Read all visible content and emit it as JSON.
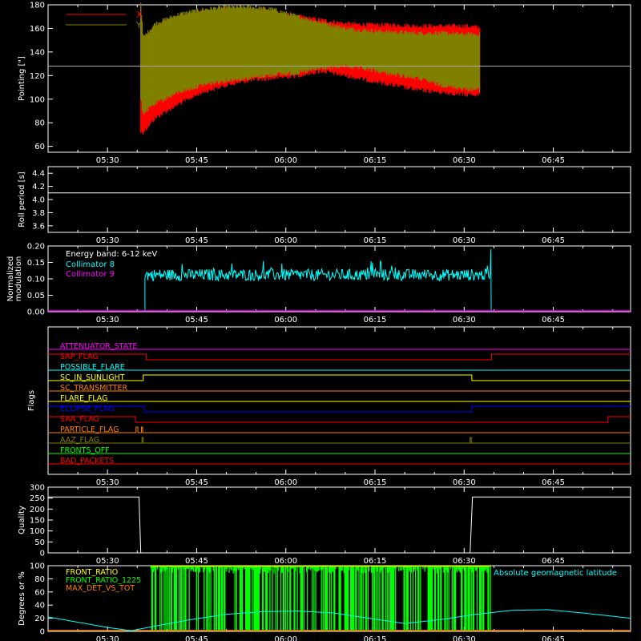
{
  "time_axis": {
    "ticks": [
      "05:30",
      "05:45",
      "06:00",
      "06:15",
      "06:30",
      "06:45"
    ],
    "tick_minutes": [
      330,
      345,
      360,
      375,
      390,
      405
    ],
    "range_minutes": [
      320,
      418
    ]
  },
  "chart_data": [
    {
      "id": "pointing",
      "type": "line",
      "ylabel": "Pointing [\"]",
      "ylim": [
        55,
        180
      ],
      "yticks": [
        60,
        80,
        100,
        120,
        140,
        160,
        180
      ],
      "reference_line": 128,
      "legend": [
        {
          "name": "X",
          "color": "#ff0000"
        },
        {
          "name": "Y",
          "color": "#808000"
        }
      ],
      "series": [
        {
          "name": "X",
          "color": "#ff0000",
          "x": [
            335.6,
            336,
            338,
            342,
            346,
            350,
            354,
            358,
            362,
            366,
            370,
            374,
            378,
            382,
            386,
            390,
            392.7
          ],
          "upper": [
            178,
            150,
            162,
            170,
            174,
            176,
            176,
            174,
            170,
            167,
            164,
            163,
            163,
            162,
            162,
            162,
            161
          ],
          "lower": [
            72,
            72,
            84,
            96,
            106,
            112,
            116,
            118,
            120,
            124,
            120,
            116,
            112,
            108,
            106,
            104,
            104
          ]
        },
        {
          "name": "Y",
          "color": "#808000",
          "x": [
            335.6,
            336,
            338,
            342,
            346,
            350,
            354,
            358,
            362,
            366,
            370,
            374,
            378,
            382,
            386,
            390,
            392.7
          ],
          "upper": [
            182,
            152,
            164,
            172,
            176,
            178,
            178,
            176,
            170,
            165,
            160,
            158,
            157,
            156,
            156,
            155,
            155
          ],
          "lower": [
            100,
            88,
            96,
            106,
            112,
            116,
            118,
            121,
            122,
            126,
            128,
            125,
            121,
            118,
            112,
            109,
            108
          ]
        }
      ]
    },
    {
      "id": "roll",
      "type": "line",
      "ylabel": "Roll period [s]",
      "ylim": [
        3.5,
        4.5
      ],
      "yticks": [
        3.6,
        3.8,
        4.0,
        4.2,
        4.4
      ],
      "series": [
        {
          "name": "",
          "color": "#ffffff",
          "x": [
            320,
            418
          ],
          "y": [
            4.1,
            4.1
          ]
        }
      ]
    },
    {
      "id": "modulation",
      "type": "line",
      "ylabel": [
        "Normalized",
        "modulation"
      ],
      "ylim": [
        0,
        0.2
      ],
      "yticks": [
        0.0,
        0.05,
        0.1,
        0.15,
        0.2
      ],
      "legend_text": "Energy band: 6-12 keV",
      "legend": [
        {
          "name": "Collimator 8",
          "color": "#00ffff"
        },
        {
          "name": "Collimator 9",
          "color": "#ff00ff"
        }
      ],
      "collimator8": {
        "start": 336.3,
        "end": 394.5,
        "mean": 0.112,
        "amp": 0.018,
        "spike_end": 0.19
      },
      "collimator9": {
        "level": 0.0
      }
    },
    {
      "id": "flags",
      "type": "line",
      "ylabel": "Flags",
      "flags": [
        {
          "name": "ATTENUATOR_STATE",
          "color": "#ff00ff",
          "steps": [
            [
              320,
              0
            ]
          ]
        },
        {
          "name": "SAP_FLAG",
          "color": "#ff0000",
          "steps": [
            [
              320,
              1
            ],
            [
              336.5,
              0
            ],
            [
              394.6,
              1
            ]
          ]
        },
        {
          "name": "POSSIBLE_FLARE",
          "color": "#00ffff",
          "steps": [
            [
              320,
              0
            ]
          ]
        },
        {
          "name": "SC_IN_SUNLIGHT",
          "color": "#ffff00",
          "steps": [
            [
              320,
              0
            ],
            [
              336.0,
              1
            ],
            [
              391.3,
              0
            ]
          ]
        },
        {
          "name": "SC_TRANSMITTER",
          "color": "#ff7f00",
          "steps": [
            [
              320,
              0
            ]
          ]
        },
        {
          "name": "FLARE_FLAG",
          "color": "#ffff00",
          "steps": [
            [
              320,
              0
            ]
          ]
        },
        {
          "name": "ECLIPSE_FLAG",
          "color": "#0000ff",
          "steps": [
            [
              320,
              1
            ],
            [
              336.2,
              0
            ],
            [
              391.3,
              1
            ]
          ]
        },
        {
          "name": "SAA_FLAG",
          "color": "#ff0000",
          "steps": [
            [
              320,
              1
            ],
            [
              334.7,
              0
            ],
            [
              414.2,
              1
            ]
          ]
        },
        {
          "name": "PARTICLE_FLAG",
          "color": "#ff7f00",
          "steps": [
            [
              320,
              0
            ],
            [
              334.8,
              1
            ],
            [
              335.1,
              0
            ],
            [
              335.7,
              1
            ],
            [
              335.9,
              0
            ]
          ]
        },
        {
          "name": "AAZ_FLAG",
          "color": "#808000",
          "steps": [
            [
              320,
              0
            ],
            [
              335.8,
              1
            ],
            [
              336.0,
              0
            ],
            [
              391.0,
              1
            ],
            [
              391.2,
              0
            ]
          ]
        },
        {
          "name": "FRONTS_OFF",
          "color": "#00ff00",
          "steps": [
            [
              320,
              0
            ]
          ]
        },
        {
          "name": "BAD_PACKETS",
          "color": "#ff0000",
          "steps": [
            [
              320,
              0
            ]
          ]
        }
      ]
    },
    {
      "id": "quality",
      "type": "line",
      "ylabel": "Quality",
      "ylim": [
        0,
        300
      ],
      "yticks": [
        0,
        50,
        100,
        150,
        200,
        250,
        300
      ],
      "series": [
        {
          "name": "",
          "color": "#ffffff",
          "x": [
            320,
            335.3,
            335.6,
            391.0,
            391.4,
            418
          ],
          "y": [
            255,
            255,
            0,
            0,
            255,
            255
          ]
        }
      ]
    },
    {
      "id": "degrees",
      "type": "line",
      "ylabel": "Degrees or %",
      "ylim": [
        0,
        100
      ],
      "yticks": [
        0,
        20,
        40,
        60,
        80,
        100
      ],
      "legend": [
        {
          "name": "FRONT_RATIO",
          "color": "#ffff00"
        },
        {
          "name": "FRONT_RATIO_1225",
          "color": "#00ff00"
        },
        {
          "name": "MAX_DET_VS_TOT",
          "color": "#ff7f00"
        }
      ],
      "right_label": {
        "name": "Absolute geomagnetic latitude",
        "color": "#00ffff"
      },
      "latitude": {
        "x": [
          320,
          325,
          330,
          334,
          338,
          344,
          350,
          356,
          362,
          368,
          374,
          380,
          386,
          392,
          398,
          404,
          410,
          418
        ],
        "y": [
          22,
          14,
          6,
          1,
          8,
          18,
          26,
          30,
          31,
          28,
          20,
          12,
          18,
          26,
          32,
          33,
          28,
          20
        ]
      },
      "ratio_band": {
        "start": 337.3,
        "end": 394.5
      }
    }
  ]
}
